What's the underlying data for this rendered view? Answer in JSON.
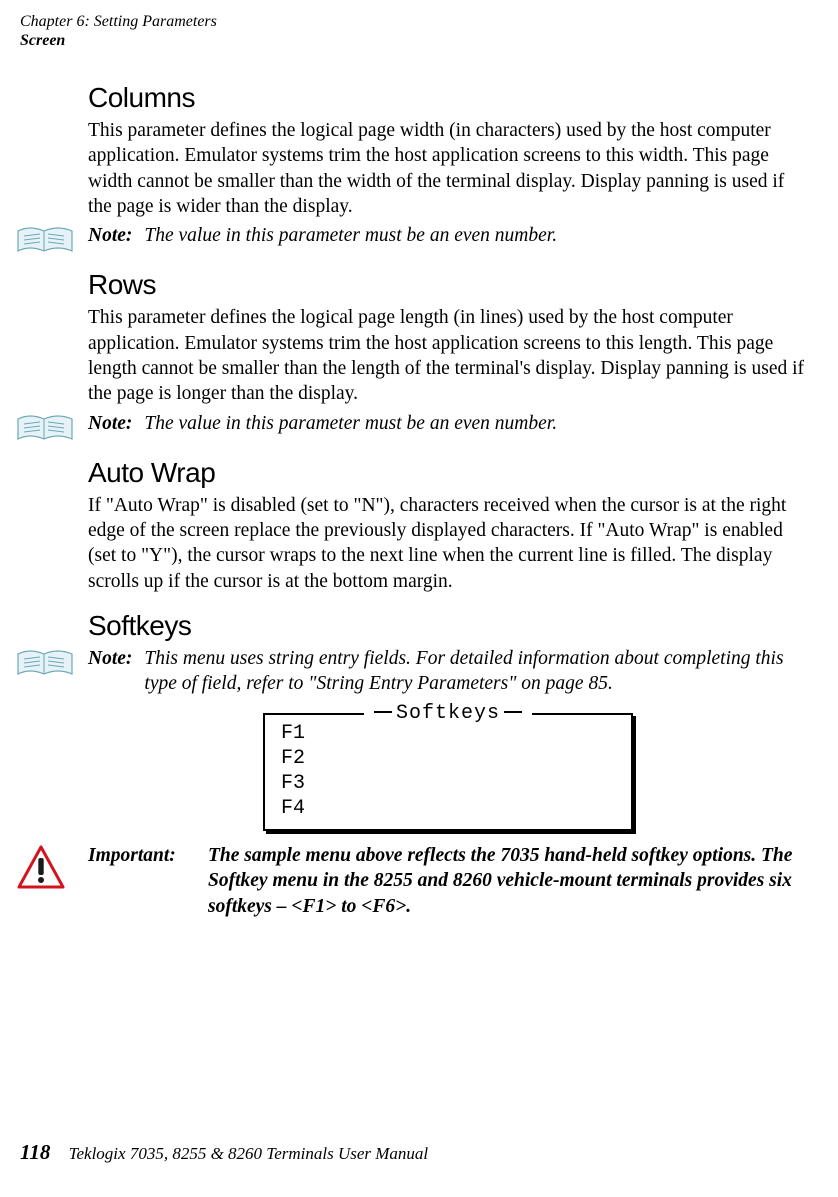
{
  "header": {
    "chapter_line": "Chapter  6:  Setting Parameters",
    "section_line": "Screen"
  },
  "sections": {
    "columns": {
      "heading": "Columns",
      "body": "This parameter defines the logical page width (in characters) used by the host computer application. Emulator systems trim the host application screens to this width. This page width cannot be smaller than the width of the terminal display. Display panning is used if the page is wider than the display.",
      "note_label": "Note:",
      "note_text": "The value in this parameter must be an even number."
    },
    "rows": {
      "heading": "Rows",
      "body": "This parameter defines the logical page length (in lines) used by the host computer application. Emulator systems trim the host application screens to this length. This page length cannot be smaller than the length of the terminal's display. Display panning is used if the page is longer than the display.",
      "note_label": "Note:",
      "note_text": "The value in this parameter must be an even number."
    },
    "autowrap": {
      "heading": "Auto Wrap",
      "body": "If \"Auto Wrap\" is disabled (set to \"N\"), characters received when the cursor is at the right edge of the screen replace the previously displayed characters. If \"Auto Wrap\" is enabled (set to \"Y\"), the cursor wraps to the next line when the current line is filled. The display scrolls up if the cursor is at the bottom margin."
    },
    "softkeys": {
      "heading": "Softkeys",
      "note_label": "Note:",
      "note_text": "This menu uses string entry fields. For detailed information about completing this type of field, refer to \"String Entry Parameters\" on page 85.",
      "menu_title": "Softkeys",
      "menu_items": [
        "F1",
        "F2",
        "F3",
        "F4"
      ],
      "important_label": "Important:",
      "important_text": "The sample menu above reflects the 7035 hand-held softkey options. The Softkey menu in the 8255 and 8260 vehicle-mount terminals provides six softkeys – <F1> to <F6>."
    }
  },
  "footer": {
    "page_number": "118",
    "manual_title": "Teklogix 7035, 8255 & 8260 Terminals User Manual"
  }
}
